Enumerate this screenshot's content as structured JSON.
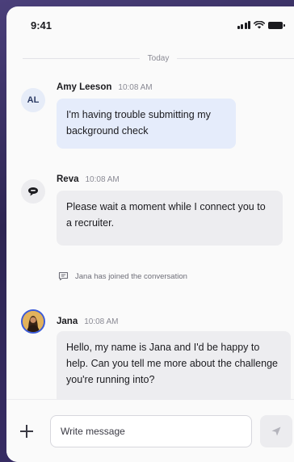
{
  "status_bar": {
    "time": "9:41"
  },
  "divider": {
    "label": "Today"
  },
  "messages": [
    {
      "initials": "AL",
      "sender": "Amy Leeson",
      "time": "10:08 AM",
      "text": "I'm having trouble submitting my background check"
    },
    {
      "sender": "Reva",
      "time": "10:08 AM",
      "text": "Please wait a moment while I connect you to a recruiter."
    },
    {
      "sender": "Jana",
      "time": "10:08 AM",
      "text": "Hello, my name is Jana and I'd be happy to help. Can you tell me more about the challenge you're running into?"
    }
  ],
  "system_event": {
    "text": "Jana has joined the conversation"
  },
  "composer": {
    "placeholder": "Write message"
  },
  "colors": {
    "user_bubble": "#e5ecfb",
    "bot_bubble": "#ededf0",
    "accent": "#3b5bd9"
  }
}
